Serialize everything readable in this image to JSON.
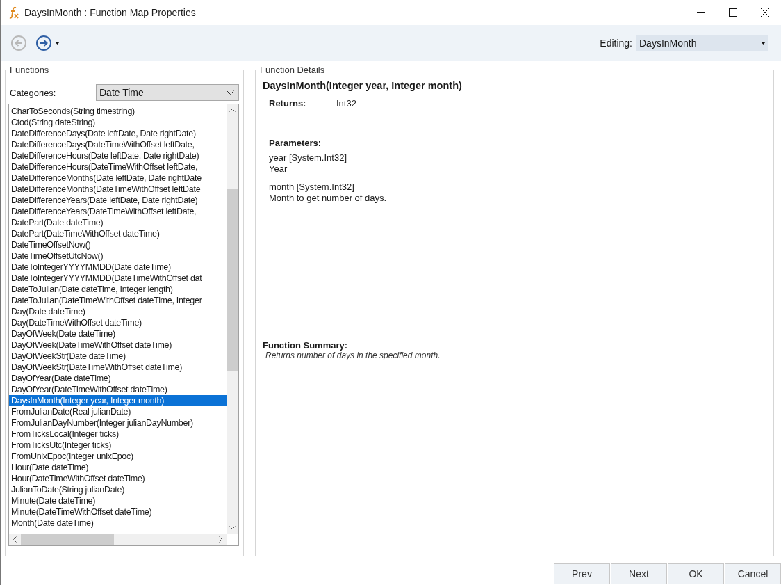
{
  "window": {
    "title": "DaysInMonth : Function Map Properties"
  },
  "toolbar": {
    "nav_buttons": [
      {
        "kind": "back",
        "disabled": true
      },
      {
        "kind": "forward",
        "disabled": false
      }
    ],
    "editing_label": "Editing:",
    "editing_value": "DaysInMonth"
  },
  "functions": {
    "title": "Functions",
    "categories_label": "Categories:",
    "category": "Date Time",
    "items": [
      {
        "label": "CharToSeconds(String timestring)",
        "selected": false
      },
      {
        "label": "Ctod(String dateString)",
        "selected": false
      },
      {
        "label": "DateDifferenceDays(Date leftDate, Date rightDate)",
        "selected": false
      },
      {
        "label": "DateDifferenceDays(DateTimeWithOffset leftDate,",
        "selected": false
      },
      {
        "label": "DateDifferenceHours(Date leftDate, Date rightDate)",
        "selected": false
      },
      {
        "label": "DateDifferenceHours(DateTimeWithOffset leftDate,",
        "selected": false
      },
      {
        "label": "DateDifferenceMonths(Date leftDate, Date rightDate",
        "selected": false
      },
      {
        "label": "DateDifferenceMonths(DateTimeWithOffset leftDate",
        "selected": false
      },
      {
        "label": "DateDifferenceYears(Date leftDate, Date rightDate)",
        "selected": false
      },
      {
        "label": "DateDifferenceYears(DateTimeWithOffset leftDate,",
        "selected": false
      },
      {
        "label": "DatePart(Date dateTime)",
        "selected": false
      },
      {
        "label": "DatePart(DateTimeWithOffset dateTime)",
        "selected": false
      },
      {
        "label": "DateTimeOffsetNow()",
        "selected": false
      },
      {
        "label": "DateTimeOffsetUtcNow()",
        "selected": false
      },
      {
        "label": "DateToIntegerYYYYMMDD(Date dateTime)",
        "selected": false
      },
      {
        "label": "DateToIntegerYYYYMMDD(DateTimeWithOffset dat",
        "selected": false
      },
      {
        "label": "DateToJulian(Date dateTime, Integer length)",
        "selected": false
      },
      {
        "label": "DateToJulian(DateTimeWithOffset dateTime, Integer",
        "selected": false
      },
      {
        "label": "Day(Date dateTime)",
        "selected": false
      },
      {
        "label": "Day(DateTimeWithOffset dateTime)",
        "selected": false
      },
      {
        "label": "DayOfWeek(Date dateTime)",
        "selected": false
      },
      {
        "label": "DayOfWeek(DateTimeWithOffset dateTime)",
        "selected": false
      },
      {
        "label": "DayOfWeekStr(Date dateTime)",
        "selected": false
      },
      {
        "label": "DayOfWeekStr(DateTimeWithOffset dateTime)",
        "selected": false
      },
      {
        "label": "DayOfYear(Date dateTime)",
        "selected": false
      },
      {
        "label": "DayOfYear(DateTimeWithOffset dateTime)",
        "selected": false
      },
      {
        "label": "DaysInMonth(Integer year, Integer month)",
        "selected": true
      },
      {
        "label": "FromJulianDate(Real julianDate)",
        "selected": false
      },
      {
        "label": "FromJulianDayNumber(Integer julianDayNumber)",
        "selected": false
      },
      {
        "label": "FromTicksLocal(Integer ticks)",
        "selected": false
      },
      {
        "label": "FromTicksUtc(Integer ticks)",
        "selected": false
      },
      {
        "label": "FromUnixEpoc(Integer unixEpoc)",
        "selected": false
      },
      {
        "label": "Hour(Date dateTime)",
        "selected": false
      },
      {
        "label": "Hour(DateTimeWithOffset dateTime)",
        "selected": false
      },
      {
        "label": "JulianToDate(String julianDate)",
        "selected": false
      },
      {
        "label": "Minute(Date dateTime)",
        "selected": false
      },
      {
        "label": "Minute(DateTimeWithOffset dateTime)",
        "selected": false
      },
      {
        "label": "Month(Date dateTime)",
        "selected": false
      }
    ]
  },
  "details": {
    "title": "Function Details",
    "signature": "DaysInMonth(Integer year, Integer month)",
    "returns_label": "Returns:",
    "returns": "Int32",
    "parameters_label": "Parameters:",
    "parameters": [
      {
        "name": "year [System.Int32]",
        "description": "Year"
      },
      {
        "name": "month [System.Int32]",
        "description": "Month to get number of days."
      }
    ],
    "summary_label": "Function Summary:",
    "summary": "Returns number of days in the specified month."
  },
  "buttons": [
    "Prev",
    "Next",
    "OK",
    "Cancel"
  ]
}
